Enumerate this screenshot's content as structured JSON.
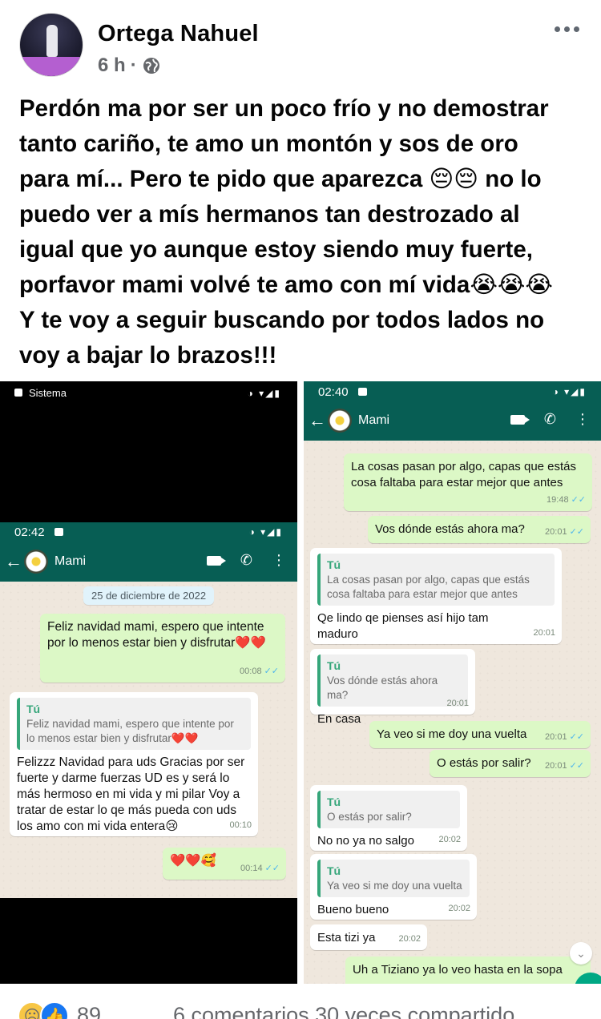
{
  "header": {
    "name": "Ortega Nahuel",
    "time": "6 h",
    "separator": "·",
    "more": "•••"
  },
  "post": {
    "lines": [
      "Perdón ma por ser un poco frío y no demostrar",
      "tanto cariño, te amo un montón y sos de oro",
      "para mí... Pero te pido que aparezca 😔😔 no lo",
      "puedo ver a mís hermanos tan destrozado al",
      "igual que yo aunque estoy siendo muy fuerte,",
      "porfavor mami volvé te amo con mí vida😭😭😭",
      "Y te voy a seguir buscando por todos lados no",
      "voy a bajar lo brazos!!!"
    ]
  },
  "left_screenshot": {
    "system_label": "Sistema",
    "status_time": "02:42",
    "contact": "Mami",
    "date_pill": "25 de diciembre de 2022",
    "msg1": {
      "text": "Feliz navidad mami, espero que intente por lo menos estar bien y disfrutar❤️❤️",
      "time": "00:08"
    },
    "msg2": {
      "quote_who": "Tú",
      "quote_text": "Feliz navidad mami, espero que intente por lo menos estar bien y disfrutar❤️❤️",
      "text": "Felizzz Navidad para uds Gracias por ser fuerte y darme fuerzas UD es y será lo más hermoso en mi vida y mi pilar Voy a tratar de estar lo qe más pueda con uds los amo con mi vida entera😢",
      "time": "00:10"
    },
    "msg3": {
      "text": "❤️❤️🥰",
      "time": "00:14"
    }
  },
  "right_screenshot": {
    "status_time": "02:40",
    "contact": "Mami",
    "m1": {
      "text": "La cosas pasan por algo, capas que estás cosa faltaba para estar mejor que antes",
      "time": "19:48"
    },
    "m2": {
      "text": "Vos dónde estás ahora ma?",
      "time": "20:01"
    },
    "m3": {
      "quote_who": "Tú",
      "quote_text": "La cosas pasan por algo, capas que estás cosa faltaba para estar mejor que antes",
      "text": "Qe lindo qe pienses así hijo tam maduro",
      "time": "20:01"
    },
    "m4": {
      "quote_who": "Tú",
      "quote_text": "Vos dónde estás ahora ma?",
      "text": "En casa",
      "time": "20:01"
    },
    "m5": {
      "text": "Ya veo si me doy una vuelta",
      "time": "20:01"
    },
    "m6": {
      "text": "O estás por salir?",
      "time": "20:01"
    },
    "m7": {
      "quote_who": "Tú",
      "quote_text": "O estás por salir?",
      "text": "No no ya no salgo",
      "time": "20:02"
    },
    "m8": {
      "quote_who": "Tú",
      "quote_text": "Ya veo si me doy una vuelta",
      "text": "Bueno bueno",
      "time": "20:02"
    },
    "m9": {
      "text": "Esta tizi ya",
      "time": "20:02"
    },
    "m10": {
      "text": "Uh a Tiziano ya lo veo hasta en la sopa"
    }
  },
  "footer": {
    "reactions_count": "89",
    "stats": "6 comentarios  30 veces compartido"
  }
}
